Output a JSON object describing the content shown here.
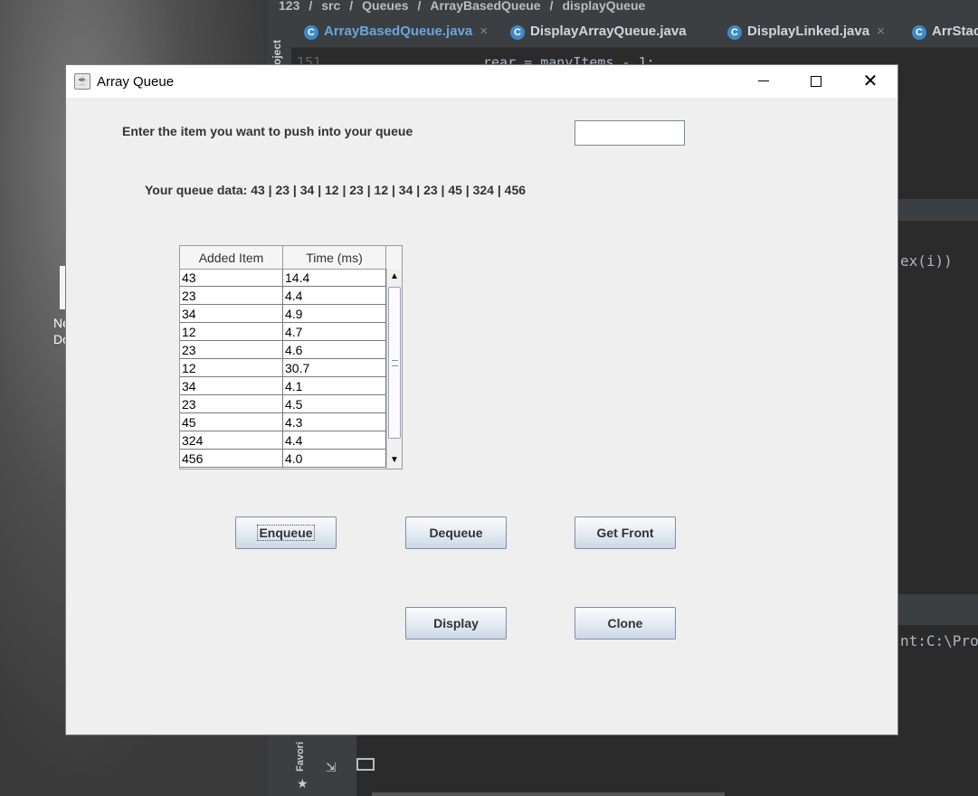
{
  "background": {
    "desktop_icon_label_1": "Ne",
    "desktop_icon_label_2": "Do",
    "ide": {
      "breadcrumb": [
        "123",
        "src",
        "Queues",
        "ArrayBasedQueue",
        "displayQueue"
      ],
      "project_label": "Project",
      "favorites_label": "Favori",
      "tabs": [
        {
          "label": "ArrayBasedQueue.java",
          "active": true
        },
        {
          "label": "DisplayArrayQueue.java",
          "active": false
        },
        {
          "label": "DisplayLinked.java",
          "active": false
        },
        {
          "label": "ArrStac",
          "active": false
        }
      ],
      "line_number": "151",
      "code_line": "rear = manyItems - 1;",
      "code_fragment_1": "ex(i))",
      "code_fragment_2": "nt:C:\\Pro"
    }
  },
  "window": {
    "title": "Array Queue",
    "prompt_label": "Enter the item you want to push into your queue",
    "input_value": "",
    "queue_label": "Your queue data: 43 | 23 | 34 | 12 | 23 | 12 | 34 | 23 | 45 | 324 | 456",
    "table": {
      "headers": [
        "Added Item",
        "Time (ms)"
      ],
      "rows": [
        [
          "43",
          "14.4"
        ],
        [
          "23",
          "4.4"
        ],
        [
          "34",
          "4.9"
        ],
        [
          "12",
          "4.7"
        ],
        [
          "23",
          "4.6"
        ],
        [
          "12",
          "30.7"
        ],
        [
          "34",
          "4.1"
        ],
        [
          "23",
          "4.5"
        ],
        [
          "45",
          "4.3"
        ],
        [
          "324",
          "4.4"
        ],
        [
          "456",
          "4.0"
        ]
      ]
    },
    "buttons": {
      "enqueue": "Enqueue",
      "dequeue": "Dequeue",
      "get_front": "Get Front",
      "display": "Display",
      "clone": "Clone"
    }
  },
  "colors": {
    "window_bg": "#efefef",
    "button_border": "#7a8fa8",
    "ide_bg": "#2b2b2b",
    "ide_tab_active": "#6aa5dd"
  }
}
